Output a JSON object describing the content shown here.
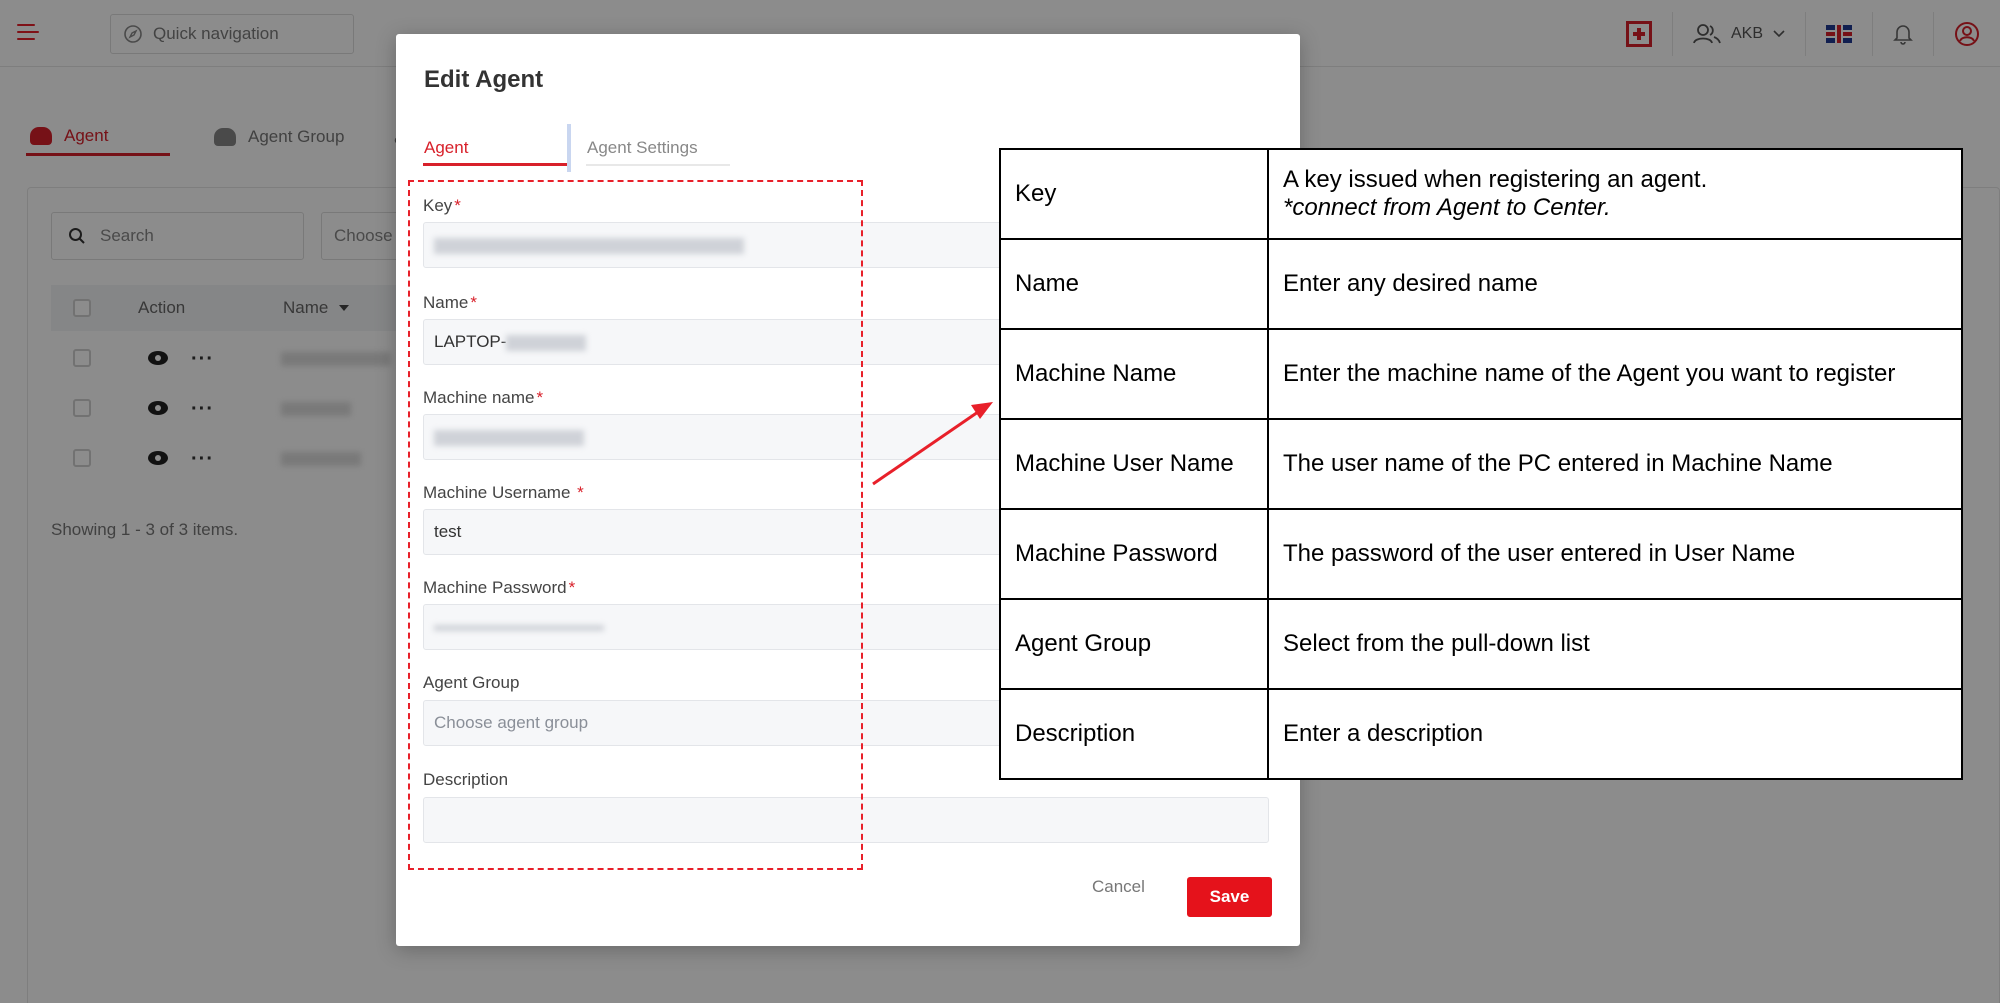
{
  "topbar": {
    "quick_nav_label": "Quick navigation",
    "user_label": "AKB"
  },
  "page_tabs": [
    {
      "label": "Agent"
    },
    {
      "label": "Agent Group"
    }
  ],
  "list": {
    "search_placeholder": "Search",
    "choose_label": "Choose",
    "columns": [
      "Action",
      "Name"
    ],
    "showing_text": "Showing 1 - 3 of 3 items."
  },
  "modal": {
    "title": "Edit Agent",
    "tabs": [
      {
        "label": "Agent",
        "active": true
      },
      {
        "label": "Agent Settings",
        "active": false
      }
    ],
    "fields": {
      "key": {
        "label": "Key",
        "required_mark": "*",
        "value_hidden": true
      },
      "name": {
        "label": "Name",
        "required_mark": "*",
        "value_prefix": "LAPTOP-"
      },
      "machine_name": {
        "label": "Machine name",
        "required_mark": "*",
        "value_hidden": true
      },
      "machine_username": {
        "label": "Machine Username",
        "required_mark": "*",
        "value": "test"
      },
      "machine_password": {
        "label": "Machine Password",
        "required_mark": "*",
        "value_hidden": true
      },
      "agent_group": {
        "label": "Agent Group",
        "placeholder": "Choose agent group"
      },
      "description": {
        "label": "Description",
        "value": ""
      }
    },
    "cancel_label": "Cancel",
    "save_label": "Save"
  },
  "annotation_table": [
    {
      "key": "Key",
      "desc": "A key issued when registering an agent.",
      "desc_note": "*connect from Agent to Center."
    },
    {
      "key": "Name",
      "desc": "Enter any desired name"
    },
    {
      "key": "Machine Name",
      "desc": "Enter the machine name of the Agent you want to register"
    },
    {
      "key": "Machine User Name",
      "desc": "The user name of the PC entered in Machine Name"
    },
    {
      "key": "Machine Password",
      "desc": "The password of the user entered in User Name"
    },
    {
      "key": "Agent Group",
      "desc": "Select from the pull-down list"
    },
    {
      "key": "Description",
      "desc": "Enter a description"
    }
  ],
  "colors": {
    "accent": "#e8202a",
    "save_button": "#e5121b"
  }
}
